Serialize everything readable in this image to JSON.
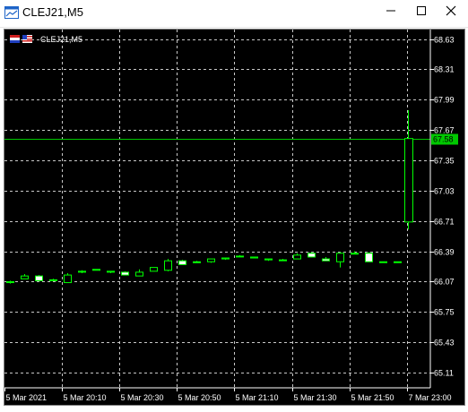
{
  "window": {
    "title": "CLEJ21,M5"
  },
  "chart_data": {
    "type": "candlestick",
    "symbol_label": "CLEJ21,M5",
    "price_ticks": [
      "68.63",
      "68.31",
      "67.99",
      "67.67",
      "67.35",
      "67.03",
      "66.71",
      "66.39",
      "66.07",
      "65.75",
      "65.43",
      "65.11"
    ],
    "price_min": 64.95,
    "price_max": 68.73,
    "time_ticks": [
      "5 Mar 2021",
      "5 Mar 20:10",
      "5 Mar 20:30",
      "5 Mar 20:50",
      "5 Mar 21:10",
      "5 Mar 21:30",
      "5 Mar 21:50",
      "7 Mar 23:00"
    ],
    "current_price": "67.58",
    "colors": {
      "background": "#000000",
      "grid": "#c8c8c8",
      "bull": "#00ff00",
      "price_line": "#00c800",
      "text": "#ffffff"
    },
    "candles": [
      {
        "o": 66.06,
        "h": 66.08,
        "l": 66.05,
        "c": 66.07
      },
      {
        "o": 66.1,
        "h": 66.15,
        "l": 66.1,
        "c": 66.13
      },
      {
        "o": 66.13,
        "h": 66.14,
        "l": 66.08,
        "c": 66.08
      },
      {
        "o": 66.09,
        "h": 66.1,
        "l": 66.08,
        "c": 66.09
      },
      {
        "o": 66.06,
        "h": 66.16,
        "l": 66.06,
        "c": 66.14
      },
      {
        "o": 66.17,
        "h": 66.19,
        "l": 66.16,
        "c": 66.18
      },
      {
        "o": 66.19,
        "h": 66.2,
        "l": 66.19,
        "c": 66.2
      },
      {
        "o": 66.17,
        "h": 66.18,
        "l": 66.16,
        "c": 66.18
      },
      {
        "o": 66.17,
        "h": 66.18,
        "l": 66.14,
        "c": 66.14
      },
      {
        "o": 66.13,
        "h": 66.2,
        "l": 66.13,
        "c": 66.17
      },
      {
        "o": 66.18,
        "h": 66.22,
        "l": 66.18,
        "c": 66.22
      },
      {
        "o": 66.19,
        "h": 66.31,
        "l": 66.18,
        "c": 66.29
      },
      {
        "o": 66.29,
        "h": 66.3,
        "l": 66.25,
        "c": 66.25
      },
      {
        "o": 66.28,
        "h": 66.29,
        "l": 66.27,
        "c": 66.27
      },
      {
        "o": 66.28,
        "h": 66.31,
        "l": 66.27,
        "c": 66.31
      },
      {
        "o": 66.31,
        "h": 66.32,
        "l": 66.3,
        "c": 66.32
      },
      {
        "o": 66.34,
        "h": 66.35,
        "l": 66.33,
        "c": 66.34
      },
      {
        "o": 66.32,
        "h": 66.33,
        "l": 66.32,
        "c": 66.33
      },
      {
        "o": 66.3,
        "h": 66.31,
        "l": 66.29,
        "c": 66.31
      },
      {
        "o": 66.3,
        "h": 66.31,
        "l": 66.29,
        "c": 66.3
      },
      {
        "o": 66.31,
        "h": 66.37,
        "l": 66.31,
        "c": 66.35
      },
      {
        "o": 66.37,
        "h": 66.38,
        "l": 66.33,
        "c": 66.33
      },
      {
        "o": 66.31,
        "h": 66.33,
        "l": 66.29,
        "c": 66.29
      },
      {
        "o": 66.28,
        "h": 66.38,
        "l": 66.22,
        "c": 66.37
      },
      {
        "o": 66.37,
        "h": 66.39,
        "l": 66.36,
        "c": 66.37
      },
      {
        "o": 66.37,
        "h": 66.38,
        "l": 66.28,
        "c": 66.28
      },
      {
        "o": 66.28,
        "h": 66.28,
        "l": 66.28,
        "c": 66.28
      },
      {
        "o": 66.28,
        "h": 66.28,
        "l": 66.28,
        "c": 66.28
      },
      {
        "o": 66.7,
        "h": 67.88,
        "l": 66.62,
        "c": 67.58
      }
    ]
  }
}
